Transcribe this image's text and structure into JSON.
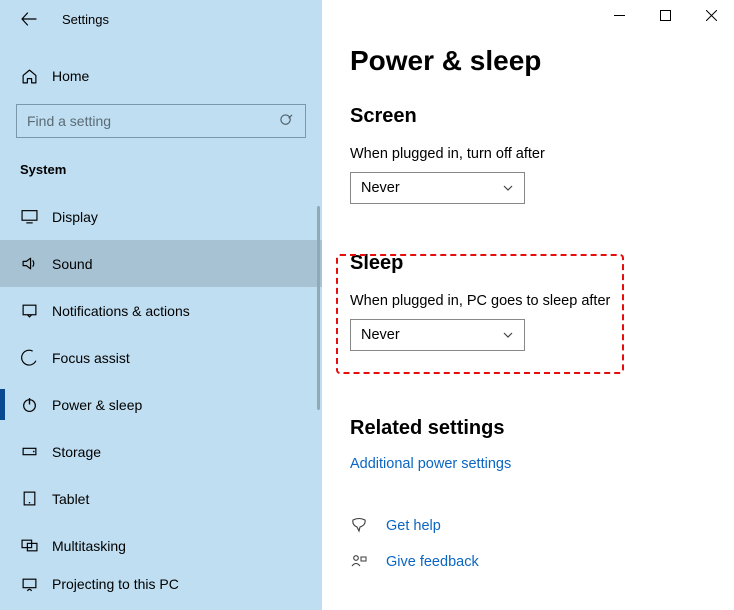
{
  "window": {
    "title": "Settings"
  },
  "home": {
    "label": "Home"
  },
  "search": {
    "placeholder": "Find a setting"
  },
  "section": {
    "title": "System"
  },
  "nav": {
    "items": [
      {
        "label": "Display"
      },
      {
        "label": "Sound"
      },
      {
        "label": "Notifications & actions"
      },
      {
        "label": "Focus assist"
      },
      {
        "label": "Power & sleep"
      },
      {
        "label": "Storage"
      },
      {
        "label": "Tablet"
      },
      {
        "label": "Multitasking"
      },
      {
        "label": "Projecting to this PC"
      }
    ]
  },
  "page": {
    "title": "Power & sleep",
    "screen": {
      "heading": "Screen",
      "label": "When plugged in, turn off after",
      "value": "Never"
    },
    "sleep": {
      "heading": "Sleep",
      "label": "When plugged in, PC goes to sleep after",
      "value": "Never"
    },
    "related": {
      "heading": "Related settings",
      "link": "Additional power settings"
    },
    "help": {
      "label": "Get help"
    },
    "feedback": {
      "label": "Give feedback"
    }
  }
}
